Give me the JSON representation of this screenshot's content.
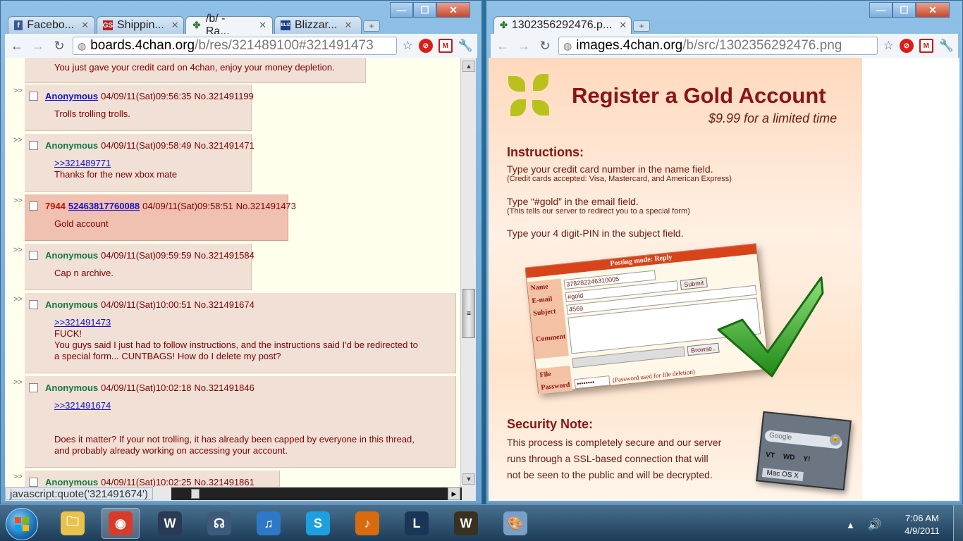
{
  "window_left": {
    "tabs": [
      {
        "label": "Facebo...",
        "favicon": "facebook-icon",
        "favicon_text": "f",
        "color": "#3b5998"
      },
      {
        "label": "Shippin...",
        "favicon": "gs-icon",
        "favicon_text": "GS",
        "color": "#b21d1d"
      },
      {
        "label": "/b/ - Ra...",
        "favicon": "clover-icon",
        "favicon_text": "✤",
        "color": "#2f7a2f"
      },
      {
        "label": "Blizzar...",
        "favicon": "blizzard-icon",
        "favicon_text": "BLIZ",
        "color": "#1d3f8a"
      }
    ],
    "url_host": "boards.4chan.org",
    "url_path": "/b/res/321489100#321491473",
    "status_text": "javascript:quote('321491674')",
    "top_post_text": "You just gave your credit card on 4chan, enjoy your money depletion.",
    "posts": [
      {
        "name": "Anonymous",
        "datetime": "04/09/11(Sat)09:56:35",
        "no": "No.321491199",
        "lines": [
          "Trolls trolling trolls."
        ]
      },
      {
        "name": "Anonymous",
        "datetime": "04/09/11(Sat)09:58:49",
        "no": "No.321491471",
        "quote": ">>321489771",
        "lines": [
          "Thanks for the new xbox mate"
        ]
      },
      {
        "trip": "7944",
        "id": "52463817760088",
        "datetime": "04/09/11(Sat)09:58:51",
        "no": "No.321491473",
        "lines": [
          "Gold account"
        ]
      },
      {
        "name": "Anonymous",
        "datetime": "04/09/11(Sat)09:59:59",
        "no": "No.321491584",
        "lines": [
          "Cap n archive."
        ]
      },
      {
        "name": "Anonymous",
        "datetime": "04/09/11(Sat)10:00:51",
        "no": "No.321491674",
        "quote": ">>321491473",
        "lines": [
          "FUCK!",
          "You guys said I just had to follow instructions, and the instructions said I'd be redirected to",
          "a special form... CUNTBAGS! How do I delete my post?"
        ]
      },
      {
        "name": "Anonymous",
        "datetime": "04/09/11(Sat)10:02:18",
        "no": "No.321491846",
        "quote": ">>321491674",
        "lines": [
          "Does it matter? If your not trolling, it has already been capped by everyone in this thread,",
          "and probably already working on accessing your account."
        ]
      },
      {
        "name": "Anonymous",
        "datetime": "04/09/11(Sat)10:02:25",
        "no": "No.321491861",
        "lines": []
      }
    ],
    "post_arrow": ">>"
  },
  "window_right": {
    "tab_label": "1302356292476.p...",
    "url_host": "images.4chan.org",
    "url_path": "/b/src/1302356292476.png",
    "ad": {
      "title": "Register a Gold Account",
      "price": "$9.99 for a limited time",
      "instructions_heading": "Instructions:",
      "line1": "Type your credit card number in the name field.",
      "line1_sub": "(Credit cards accepted: Visa, Mastercard, and American Express)",
      "line2": "Type “#gold” in the email field.",
      "line2_sub": "(This tells our server to redirect you to a special form)",
      "line3": "Type your 4 digit-PIN in the subject field.",
      "security_heading": "Security Note:",
      "security_lines": [
        "This process is completely secure and our server",
        "runs through a SSL-based connection that will",
        "not be seen to the public and will be decrypted."
      ],
      "form": {
        "header": "Posting mode: Reply",
        "name_label": "Name",
        "name_value": "378282246310005",
        "email_label": "E-mail",
        "email_value": "#gold",
        "submit": "Submit",
        "subject_label": "Subject",
        "subject_value": "4569",
        "comment_label": "Comment",
        "file_label": "File",
        "browse": "Browse..",
        "password_label": "Password",
        "password_value": "••••••••",
        "password_note": "(Password used for file deletion)"
      },
      "laptop": {
        "search": "Google",
        "keys": [
          "VT",
          "WD",
          "Y!"
        ],
        "os": "Mac OS X"
      }
    }
  },
  "taskbar": {
    "apps": [
      {
        "name": "explorer-icon",
        "glyph": "🗀",
        "bg": "#e8c24a",
        "active": false
      },
      {
        "name": "chrome-icon",
        "glyph": "◉",
        "bg": "#d93b2b",
        "active": true
      },
      {
        "name": "wow-icon",
        "glyph": "W",
        "bg": "#2b3a55",
        "active": false
      },
      {
        "name": "headset-icon",
        "glyph": "☊",
        "bg": "#3d5a7a",
        "active": false
      },
      {
        "name": "itunes-icon",
        "glyph": "♫",
        "bg": "#2e78c8",
        "active": false
      },
      {
        "name": "skype-icon",
        "glyph": "S",
        "bg": "#1ea0e0",
        "active": false
      },
      {
        "name": "audacity-icon",
        "glyph": "♪",
        "bg": "#d86a10",
        "active": false
      },
      {
        "name": "league-icon",
        "glyph": "L",
        "bg": "#1a3555",
        "active": false
      },
      {
        "name": "wow2-icon",
        "glyph": "W",
        "bg": "#3a3020",
        "active": false
      },
      {
        "name": "paint-icon",
        "glyph": "🎨",
        "bg": "#7aa0c8",
        "active": false
      }
    ],
    "time": "7:06 AM",
    "date": "4/9/2011"
  }
}
